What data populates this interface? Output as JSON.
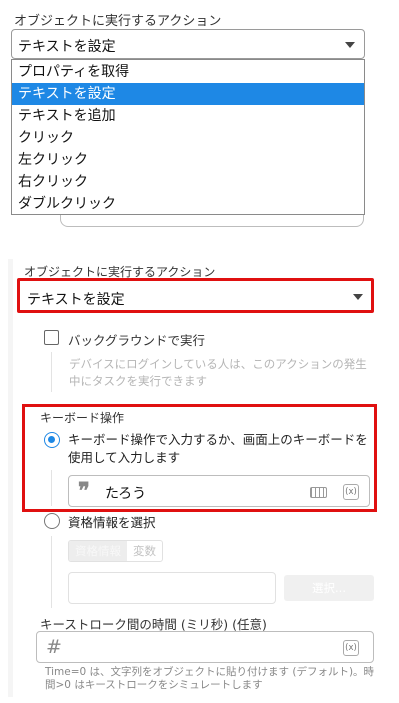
{
  "top_panel": {
    "label": "オブジェクトに実行するアクション",
    "selected": "テキストを設定",
    "options": [
      "プロパティを取得",
      "テキストを設定",
      "テキストを追加",
      "クリック",
      "左クリック",
      "右クリック",
      "ダブルクリック"
    ],
    "highlighted_index": 1
  },
  "bottom_panel": {
    "label": "オブジェクトに実行するアクション",
    "selected": "テキストを設定",
    "background_checkbox": {
      "label": "バックグラウンドで実行",
      "checked": false,
      "help": "デバイスにログインしている人は、このアクションの発生中にタスクを実行できます"
    },
    "keyboard": {
      "title": "キーボード操作",
      "option_keyboard": "キーボード操作で入力するか、画面上のキーボードを使用して入力します",
      "text_value": "たろう",
      "quote_icon": "❞",
      "var_icon": "(x)",
      "option_credential": "資格情報を選択",
      "credential_tabs": [
        "資格情報",
        "変数"
      ],
      "select_button": "選択..."
    },
    "keystroke": {
      "label": "キーストローク間の時間 (ミリ秒) (任意)",
      "hash_icon": "#",
      "var_icon": "(x)",
      "help": "Time=0 は、文字列をオブジェクトに貼り付けます (デフォルト)。時間>0 はキーストロークをシミュレートします"
    }
  },
  "colors": {
    "highlight": "#1e88e5",
    "annotation_red": "#e01010"
  }
}
